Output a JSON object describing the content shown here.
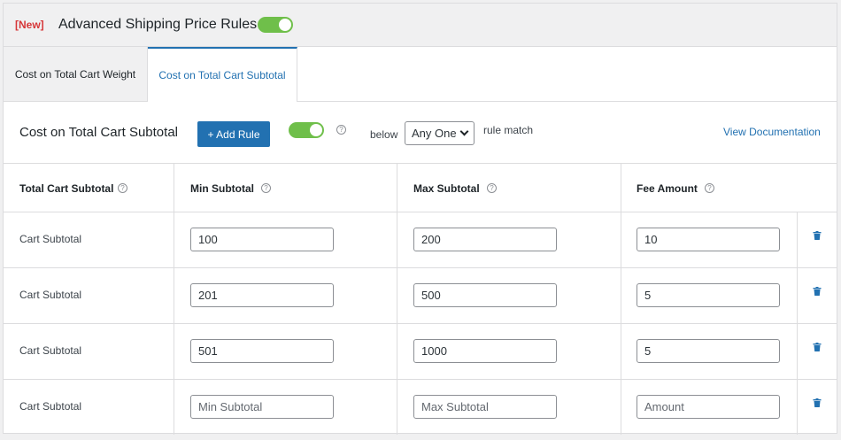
{
  "header": {
    "badge": "[New]",
    "title": "Advanced Shipping Price Rules",
    "enabled": true
  },
  "tabs": [
    {
      "label": "Cost on Total Cart Weight",
      "active": false
    },
    {
      "label": "Cost on Total Cart Subtotal",
      "active": true
    }
  ],
  "section": {
    "title": "Cost on Total Cart Subtotal",
    "add_rule_label": "+ Add Rule",
    "enabled": true,
    "below_label": "below",
    "match_select": "Any One",
    "rule_match_label": "rule match",
    "doc_link": "View Documentation"
  },
  "table": {
    "columns": [
      "Total Cart Subtotal",
      "Min Subtotal",
      "Max Subtotal",
      "Fee Amount"
    ],
    "rows": [
      {
        "label": "Cart Subtotal",
        "min": "100",
        "max": "200",
        "fee": "10"
      },
      {
        "label": "Cart Subtotal",
        "min": "201",
        "max": "500",
        "fee": "5"
      },
      {
        "label": "Cart Subtotal",
        "min": "501",
        "max": "1000",
        "fee": "5"
      },
      {
        "label": "Cart Subtotal",
        "min": "",
        "max": "",
        "fee": ""
      }
    ],
    "placeholders": {
      "min": "Min Subtotal",
      "max": "Max Subtotal",
      "fee": "Amount"
    }
  },
  "colors": {
    "accent": "#2271b1",
    "toggle_on": "#6fbf4a",
    "badge": "#d63638"
  },
  "icons": {
    "help": "question-circle-icon",
    "delete": "trash-icon",
    "dropdown": "chevron-down-icon"
  }
}
